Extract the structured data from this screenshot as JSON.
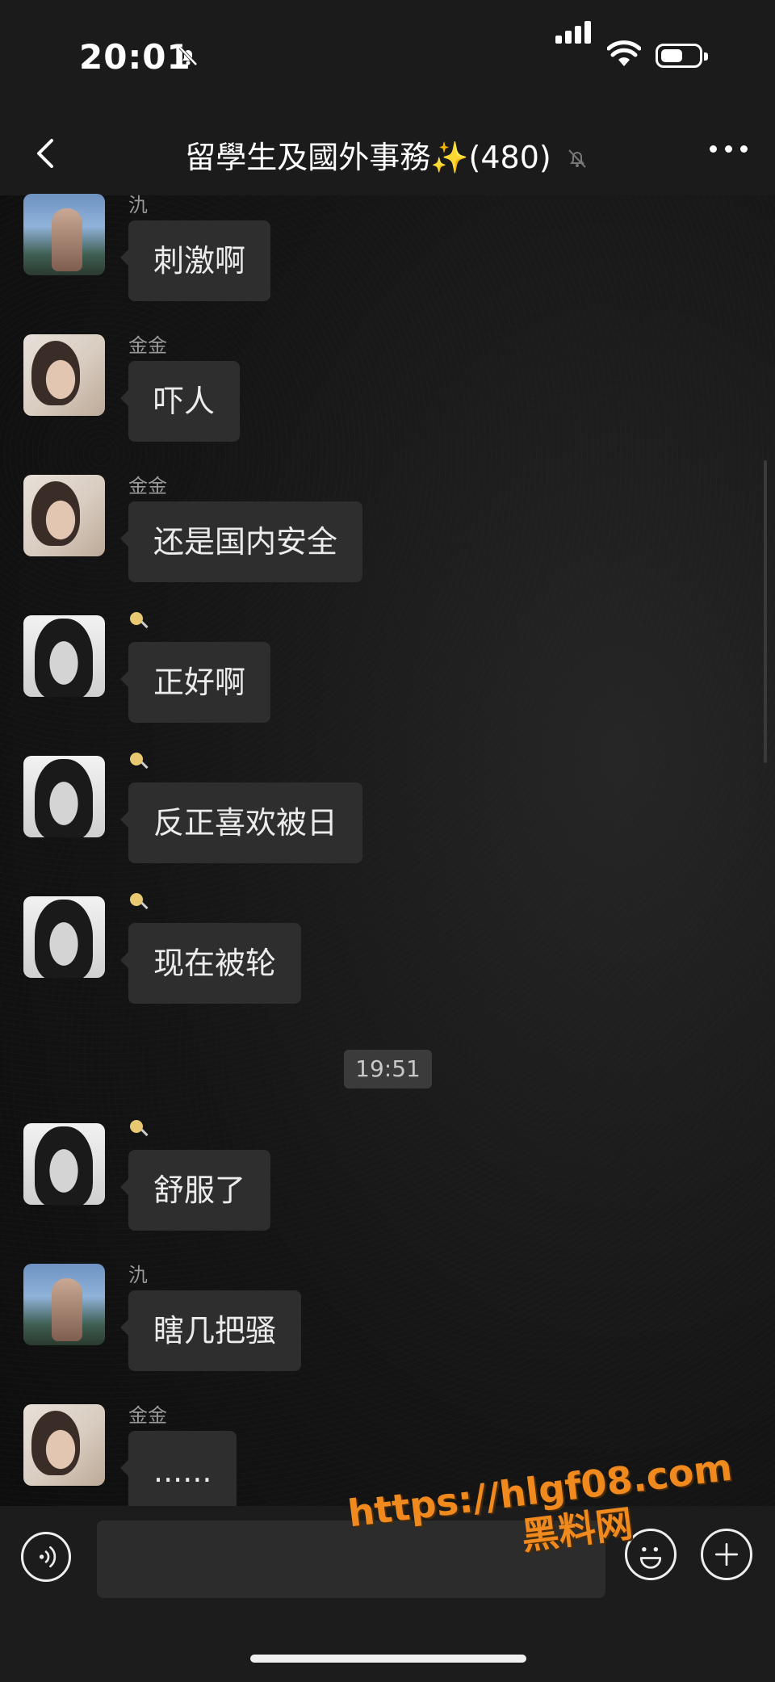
{
  "status_bar": {
    "time": "20:01"
  },
  "header": {
    "title": "留學生及國外事務✨(480)"
  },
  "messages": [
    {
      "sender": "氿",
      "text": "刺激啊"
    },
    {
      "sender": "金金",
      "text": "吓人"
    },
    {
      "sender": "金金",
      "text": "还是国内安全"
    },
    {
      "sender": "",
      "text": "正好啊"
    },
    {
      "sender": "",
      "text": "反正喜欢被日"
    },
    {
      "sender": "",
      "text": "现在被轮"
    },
    {
      "sender": "",
      "text": "舒服了"
    },
    {
      "sender": "氿",
      "text": "瞎几把骚"
    },
    {
      "sender": "金金",
      "text": "......"
    }
  ],
  "timestamp_divider": "19:51",
  "input": {
    "value": "",
    "placeholder": ""
  },
  "watermark": {
    "line1": "https://hlgf08.com",
    "line2": "黑料网"
  },
  "icons": {
    "back": "chevron-left-icon",
    "mute": "bell-slash-icon",
    "more": "more-dots-icon",
    "voice": "voice-icon",
    "emoji": "emoji-icon",
    "plus": "plus-icon"
  },
  "colors": {
    "background": "#151515",
    "bubble": "#2e2e2e",
    "watermark": "#f08a1e"
  }
}
